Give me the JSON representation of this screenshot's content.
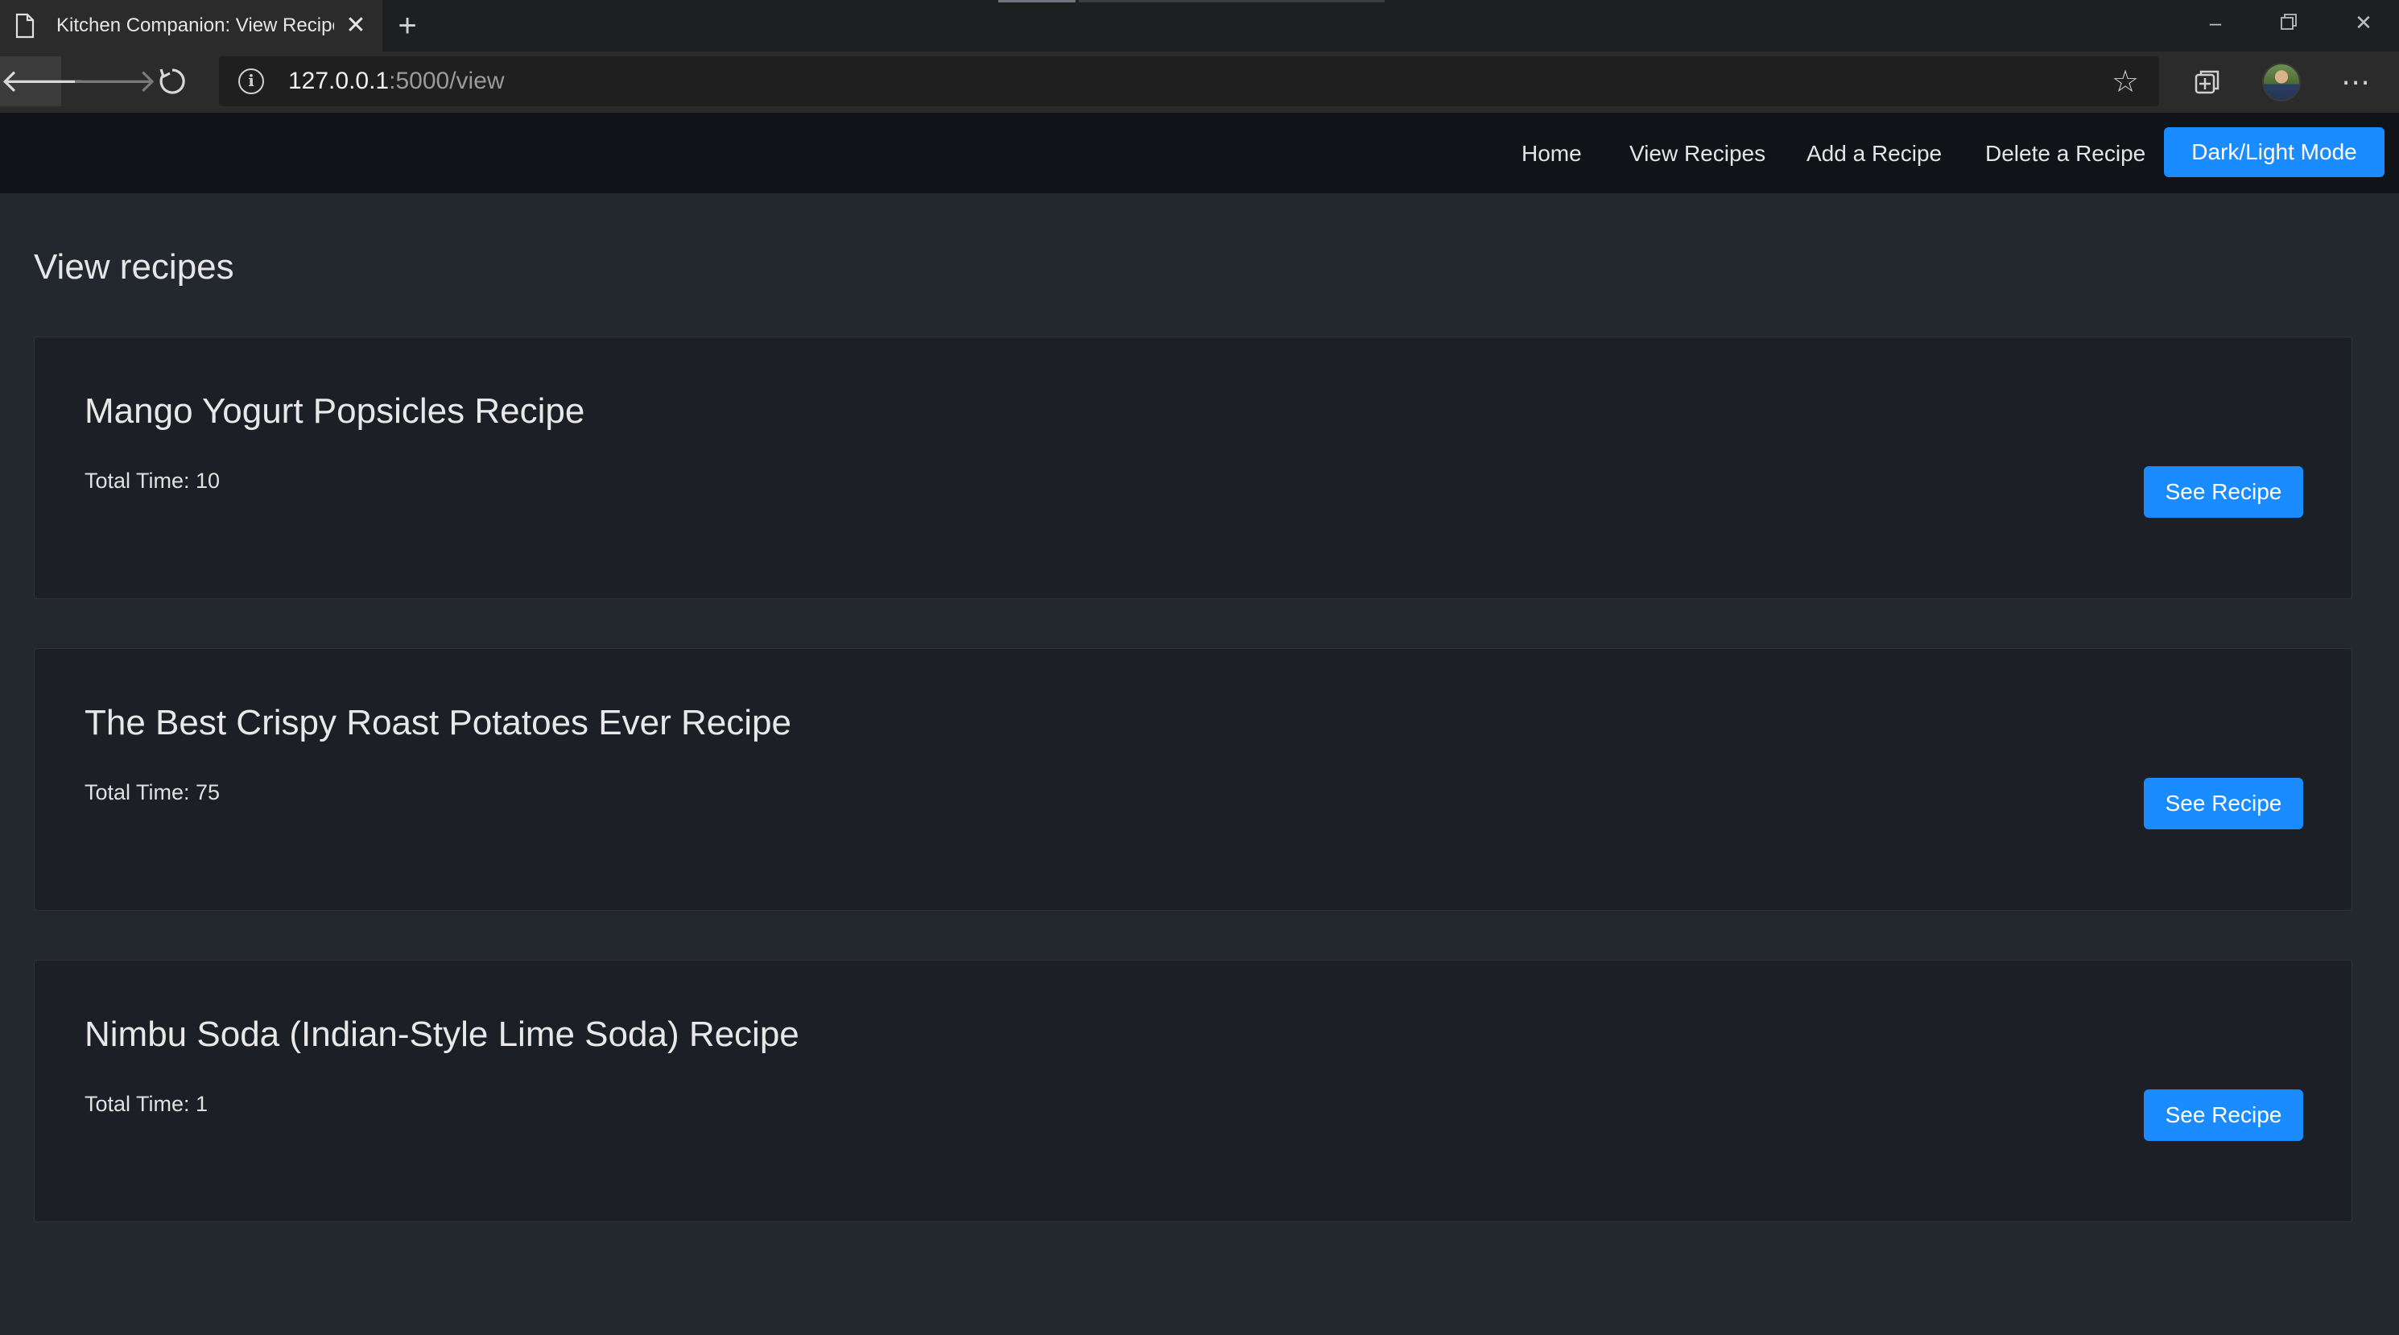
{
  "browser": {
    "tab_title": "Kitchen Companion: View Recipes",
    "new_tab_symbol": "+",
    "url_host": "127.0.0.1",
    "url_path": ":5000/view",
    "icons": [
      "document-icon",
      "close-icon",
      "new-tab-icon",
      "minimize-icon",
      "restore-icon",
      "close-window-icon",
      "back-icon",
      "forward-icon",
      "refresh-icon",
      "info-icon",
      "star-icon",
      "collections-icon",
      "profile-avatar",
      "more-icon"
    ]
  },
  "navbar": {
    "links": [
      "Home",
      "View Recipes",
      "Add a Recipe",
      "Delete a Recipe"
    ],
    "mode_button": "Dark/Light Mode"
  },
  "page": {
    "title": "View recipes"
  },
  "recipes": [
    {
      "title": "Mango Yogurt Popsicles Recipe",
      "time": "Total Time: 10",
      "button": "See Recipe"
    },
    {
      "title": "The Best Crispy Roast Potatoes Ever Recipe",
      "time": "Total Time: 75",
      "button": "See Recipe"
    },
    {
      "title": "Nimbu Soda (Indian-Style Lime Soda) Recipe",
      "time": "Total Time: 1",
      "button": "See Recipe"
    }
  ],
  "colors": {
    "page_bg": "#23272e",
    "navbar_bg": "#101317",
    "card_bg": "#1c1f25",
    "accent": "#1a8cff"
  }
}
